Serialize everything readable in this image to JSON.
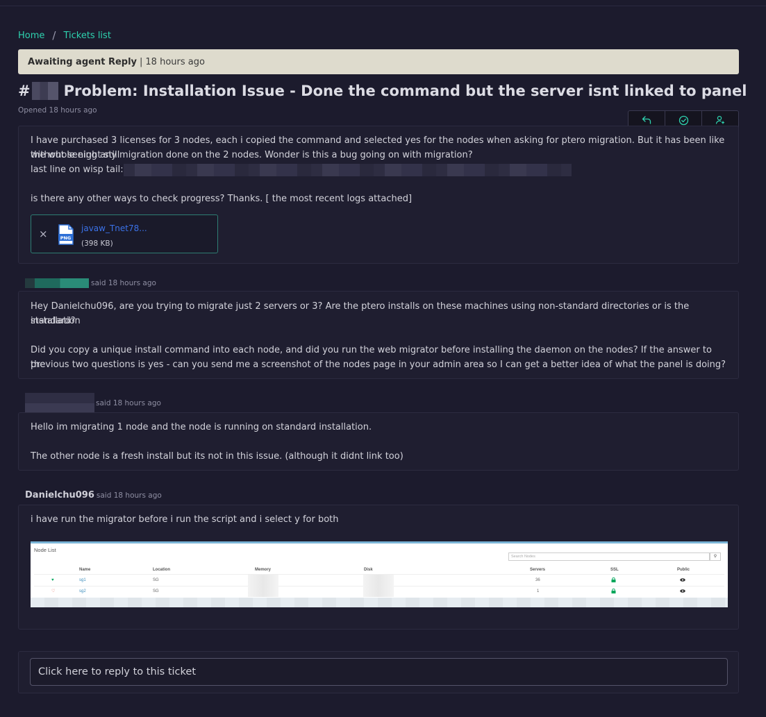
{
  "breadcrumb": {
    "home": "Home",
    "separator": "/",
    "tickets": "Tickets list"
  },
  "status": {
    "label": "Awaiting agent Reply",
    "separator": "|",
    "time": "18 hours ago"
  },
  "ticket": {
    "hash": "#",
    "title": "Problem: Installation Issue - Done the command but the server isnt linked to panel",
    "opened": "Opened 18 hours ago"
  },
  "actions": {
    "reply_icon": "reply-icon",
    "resolve_icon": "check-circle-icon",
    "assign_icon": "user-plus-icon"
  },
  "original_post": {
    "line1": "I have purchased 3 licenses for 3 nodes, each i copied the command and selected yes for the nodes when asking for ptero migration. But it has been like the whole night still",
    "line2": "without seeing any migration done on the 2 nodes. Wonder is this a bug going on with migration?",
    "line3": "last line on wisp tail:",
    "line4": "is there any other ways to check progress? Thanks. [ the most recent logs attached]",
    "attachment": {
      "close": "×",
      "type": "PNG",
      "name": "javaw_Tnet78...",
      "size": "(398 KB)"
    }
  },
  "replies": [
    {
      "said": "said 18 hours ago",
      "para1": "Hey Danielchu096, are you trying to migrate just 2 servers or 3? Are the ptero installs on these machines using non-standard directories or is the installation",
      "para1b": "standard?",
      "para2": "Did you copy a unique install command into each node, and did you run the web migrator before installing the daemon on the nodes? If the answer to the",
      "para2b": "previous two questions is yes - can you send me a screenshot of the nodes page in your admin area so I can get a better idea of what the panel is doing?"
    },
    {
      "said": "said 18 hours ago",
      "para1": "Hello im migrating 1 node and the node is running on standard installation.",
      "para2": "The other node is a fresh install but its not in this issue. (although it didnt link too)"
    },
    {
      "author": "Danielchu096",
      "said": "said 18 hours ago",
      "para1": "i have run the migrator before i run the script and i select y for both",
      "screenshot": {
        "title": "Node List",
        "search_placeholder": "Search Nodes",
        "search_icon": "magnifier-icon",
        "headers": [
          "Name",
          "Location",
          "Memory",
          "Disk",
          "Servers",
          "SSL",
          "Public"
        ],
        "rows": [
          {
            "status": "♥",
            "name": "sg1",
            "location": "SG",
            "servers": "36",
            "ssl": "lock-icon",
            "public": "eye-icon"
          },
          {
            "status": "♡",
            "name": "sg2",
            "location": "SG",
            "servers": "1",
            "ssl": "lock-icon",
            "public": "eye-icon"
          }
        ],
        "colors": {
          "online": "#00a65a",
          "offline": "#dd4b39",
          "link": "#3c8dbc"
        }
      }
    }
  ],
  "reply_box": {
    "placeholder": "Click here to reply to this ticket"
  },
  "colors": {
    "accent": "#2ed3b0",
    "background": "#1c1b2d",
    "card": "#1f1e30",
    "status_bar": "#dedbcd",
    "link": "#3b72e8"
  }
}
